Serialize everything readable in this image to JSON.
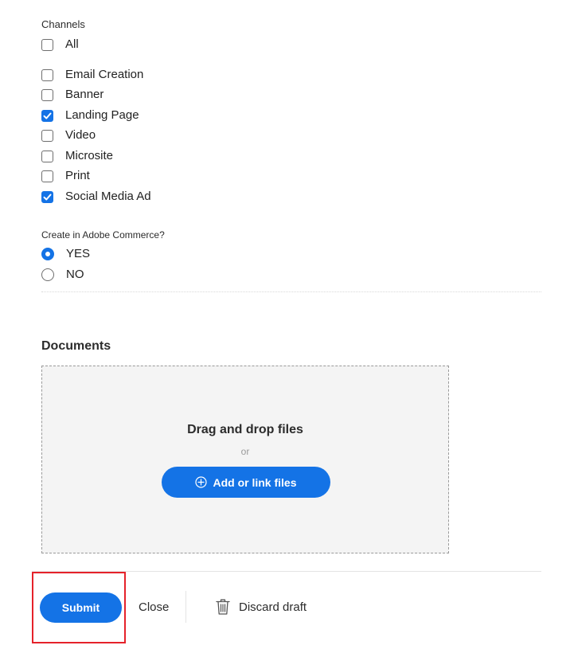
{
  "channels": {
    "label": "Channels",
    "all_label": "All",
    "all_checked": false,
    "items": [
      {
        "label": "Email Creation",
        "checked": false
      },
      {
        "label": "Banner",
        "checked": false
      },
      {
        "label": "Landing Page",
        "checked": true
      },
      {
        "label": "Video",
        "checked": false
      },
      {
        "label": "Microsite",
        "checked": false
      },
      {
        "label": "Print",
        "checked": false
      },
      {
        "label": "Social Media Ad",
        "checked": true
      }
    ]
  },
  "commerce": {
    "label": "Create in Adobe Commerce?",
    "options": [
      {
        "label": "YES",
        "selected": true
      },
      {
        "label": "NO",
        "selected": false
      }
    ]
  },
  "documents": {
    "heading": "Documents",
    "drop_title": "Drag and drop files",
    "or_text": "or",
    "add_button_label": "Add or link files",
    "add_button_icon": "plus-circle-icon"
  },
  "footer": {
    "submit_label": "Submit",
    "close_label": "Close",
    "discard_label": "Discard draft",
    "discard_icon": "trash-icon"
  },
  "colors": {
    "accent": "#1473e6",
    "highlight": "#e5222a",
    "dropzone_bg": "#f4f4f4"
  }
}
